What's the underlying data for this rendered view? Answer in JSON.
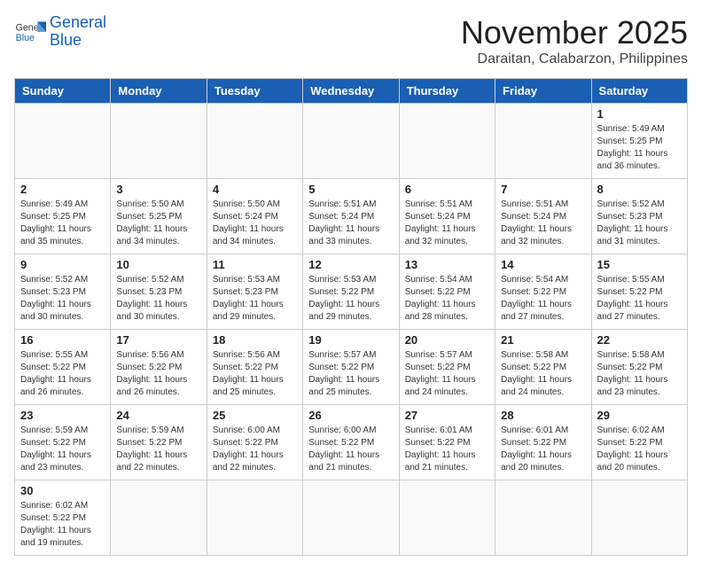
{
  "header": {
    "logo_general": "General",
    "logo_blue": "Blue",
    "month_title": "November 2025",
    "location": "Daraitan, Calabarzon, Philippines"
  },
  "weekdays": [
    "Sunday",
    "Monday",
    "Tuesday",
    "Wednesday",
    "Thursday",
    "Friday",
    "Saturday"
  ],
  "weeks": [
    [
      {
        "day": "",
        "info": ""
      },
      {
        "day": "",
        "info": ""
      },
      {
        "day": "",
        "info": ""
      },
      {
        "day": "",
        "info": ""
      },
      {
        "day": "",
        "info": ""
      },
      {
        "day": "",
        "info": ""
      },
      {
        "day": "1",
        "info": "Sunrise: 5:49 AM\nSunset: 5:25 PM\nDaylight: 11 hours\nand 36 minutes."
      }
    ],
    [
      {
        "day": "2",
        "info": "Sunrise: 5:49 AM\nSunset: 5:25 PM\nDaylight: 11 hours\nand 35 minutes."
      },
      {
        "day": "3",
        "info": "Sunrise: 5:50 AM\nSunset: 5:25 PM\nDaylight: 11 hours\nand 34 minutes."
      },
      {
        "day": "4",
        "info": "Sunrise: 5:50 AM\nSunset: 5:24 PM\nDaylight: 11 hours\nand 34 minutes."
      },
      {
        "day": "5",
        "info": "Sunrise: 5:51 AM\nSunset: 5:24 PM\nDaylight: 11 hours\nand 33 minutes."
      },
      {
        "day": "6",
        "info": "Sunrise: 5:51 AM\nSunset: 5:24 PM\nDaylight: 11 hours\nand 32 minutes."
      },
      {
        "day": "7",
        "info": "Sunrise: 5:51 AM\nSunset: 5:24 PM\nDaylight: 11 hours\nand 32 minutes."
      },
      {
        "day": "8",
        "info": "Sunrise: 5:52 AM\nSunset: 5:23 PM\nDaylight: 11 hours\nand 31 minutes."
      }
    ],
    [
      {
        "day": "9",
        "info": "Sunrise: 5:52 AM\nSunset: 5:23 PM\nDaylight: 11 hours\nand 30 minutes."
      },
      {
        "day": "10",
        "info": "Sunrise: 5:52 AM\nSunset: 5:23 PM\nDaylight: 11 hours\nand 30 minutes."
      },
      {
        "day": "11",
        "info": "Sunrise: 5:53 AM\nSunset: 5:23 PM\nDaylight: 11 hours\nand 29 minutes."
      },
      {
        "day": "12",
        "info": "Sunrise: 5:53 AM\nSunset: 5:22 PM\nDaylight: 11 hours\nand 29 minutes."
      },
      {
        "day": "13",
        "info": "Sunrise: 5:54 AM\nSunset: 5:22 PM\nDaylight: 11 hours\nand 28 minutes."
      },
      {
        "day": "14",
        "info": "Sunrise: 5:54 AM\nSunset: 5:22 PM\nDaylight: 11 hours\nand 27 minutes."
      },
      {
        "day": "15",
        "info": "Sunrise: 5:55 AM\nSunset: 5:22 PM\nDaylight: 11 hours\nand 27 minutes."
      }
    ],
    [
      {
        "day": "16",
        "info": "Sunrise: 5:55 AM\nSunset: 5:22 PM\nDaylight: 11 hours\nand 26 minutes."
      },
      {
        "day": "17",
        "info": "Sunrise: 5:56 AM\nSunset: 5:22 PM\nDaylight: 11 hours\nand 26 minutes."
      },
      {
        "day": "18",
        "info": "Sunrise: 5:56 AM\nSunset: 5:22 PM\nDaylight: 11 hours\nand 25 minutes."
      },
      {
        "day": "19",
        "info": "Sunrise: 5:57 AM\nSunset: 5:22 PM\nDaylight: 11 hours\nand 25 minutes."
      },
      {
        "day": "20",
        "info": "Sunrise: 5:57 AM\nSunset: 5:22 PM\nDaylight: 11 hours\nand 24 minutes."
      },
      {
        "day": "21",
        "info": "Sunrise: 5:58 AM\nSunset: 5:22 PM\nDaylight: 11 hours\nand 24 minutes."
      },
      {
        "day": "22",
        "info": "Sunrise: 5:58 AM\nSunset: 5:22 PM\nDaylight: 11 hours\nand 23 minutes."
      }
    ],
    [
      {
        "day": "23",
        "info": "Sunrise: 5:59 AM\nSunset: 5:22 PM\nDaylight: 11 hours\nand 23 minutes."
      },
      {
        "day": "24",
        "info": "Sunrise: 5:59 AM\nSunset: 5:22 PM\nDaylight: 11 hours\nand 22 minutes."
      },
      {
        "day": "25",
        "info": "Sunrise: 6:00 AM\nSunset: 5:22 PM\nDaylight: 11 hours\nand 22 minutes."
      },
      {
        "day": "26",
        "info": "Sunrise: 6:00 AM\nSunset: 5:22 PM\nDaylight: 11 hours\nand 21 minutes."
      },
      {
        "day": "27",
        "info": "Sunrise: 6:01 AM\nSunset: 5:22 PM\nDaylight: 11 hours\nand 21 minutes."
      },
      {
        "day": "28",
        "info": "Sunrise: 6:01 AM\nSunset: 5:22 PM\nDaylight: 11 hours\nand 20 minutes."
      },
      {
        "day": "29",
        "info": "Sunrise: 6:02 AM\nSunset: 5:22 PM\nDaylight: 11 hours\nand 20 minutes."
      }
    ],
    [
      {
        "day": "30",
        "info": "Sunrise: 6:02 AM\nSunset: 5:22 PM\nDaylight: 11 hours\nand 19 minutes."
      },
      {
        "day": "",
        "info": ""
      },
      {
        "day": "",
        "info": ""
      },
      {
        "day": "",
        "info": ""
      },
      {
        "day": "",
        "info": ""
      },
      {
        "day": "",
        "info": ""
      },
      {
        "day": "",
        "info": ""
      }
    ]
  ]
}
